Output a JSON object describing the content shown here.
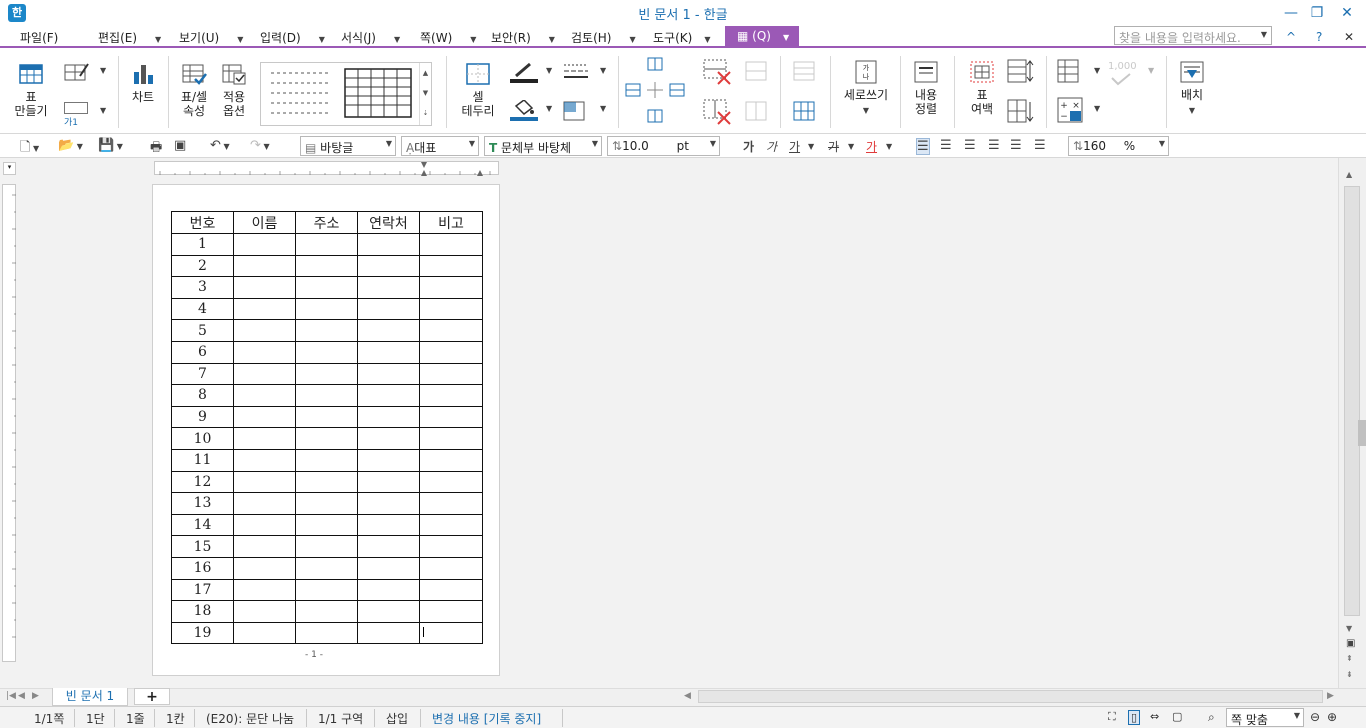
{
  "app": {
    "icon_label": "한",
    "title": "빈 문서 1 - 한글"
  },
  "window_controls": {
    "minimize": "—",
    "restore": "❐",
    "close": "✕"
  },
  "menu": {
    "items": [
      {
        "label": "파일(F)"
      },
      {
        "label": "편집(E)"
      },
      {
        "label": "보기(U)"
      },
      {
        "label": "입력(D)"
      },
      {
        "label": "서식(J)"
      },
      {
        "label": "쪽(W)"
      },
      {
        "label": "보안(R)"
      },
      {
        "label": "검토(H)"
      },
      {
        "label": "도구(K)"
      }
    ],
    "table_tab": "▦ (Q)",
    "search_placeholder": "찾을 내용을 입력하세요.",
    "collapse": "^",
    "help": "?",
    "close": "✕"
  },
  "ribbon": {
    "table_make": "표\n만들기",
    "chart": "차트",
    "table_props": "표/셀\n속성",
    "apply_options": "적용\n옵션",
    "cell_border": "셀\n테두리",
    "vertical_writing": "세로쓰기",
    "content_align": "내용\n정렬",
    "table_margin": "표\n여백",
    "layout": "배치",
    "char_sample": "가1",
    "numeric_placeholder": "1,000"
  },
  "format_bar": {
    "style": "바탕글",
    "lang": "대표",
    "font": "문체부 바탕체",
    "font_size": "10.0",
    "size_unit": "pt",
    "zoom": "160",
    "zoom_unit": "%",
    "bold": "가",
    "italic": "가",
    "underline": "가",
    "strike": "가",
    "color": "가"
  },
  "document": {
    "headers": [
      "번호",
      "이름",
      "주소",
      "연락처",
      "비고"
    ],
    "rows": [
      "1",
      "2",
      "3",
      "4",
      "5",
      "6",
      "7",
      "8",
      "9",
      "10",
      "11",
      "12",
      "13",
      "14",
      "15",
      "16",
      "17",
      "18",
      "19"
    ],
    "page_footer": "- 1 -"
  },
  "tabs": {
    "doc_tab": "빈 문서 1",
    "add_tab": "+"
  },
  "status": {
    "page": "1/1쪽",
    "column": "1단",
    "line": "1줄",
    "cell": "1칸",
    "error": "(E20): 문단 나눔",
    "section": "1/1 구역",
    "insert": "삽입",
    "track": "변경 내용 [기록 중지]",
    "zoom_mode": "쪽 맞춤"
  },
  "colors": {
    "accent_purple": "#9b59b6",
    "title_blue": "#1c6fb0"
  }
}
